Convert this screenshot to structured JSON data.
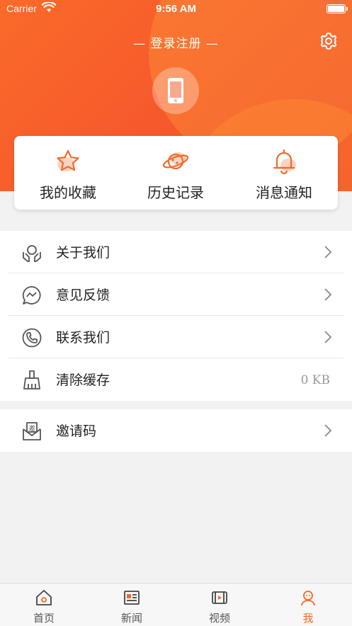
{
  "status_bar": {
    "carrier": "Carrier",
    "time": "9:56 AM"
  },
  "header": {
    "login_label": "— 登录注册 —"
  },
  "quick_actions": [
    {
      "label": "我的收藏",
      "icon": "star-icon"
    },
    {
      "label": "历史记录",
      "icon": "planet-icon"
    },
    {
      "label": "消息通知",
      "icon": "bell-icon"
    }
  ],
  "menu": {
    "about": {
      "label": "关于我们",
      "icon": "hands-heart-icon"
    },
    "feedback": {
      "label": "意见反馈",
      "icon": "chat-bubble-icon"
    },
    "contact": {
      "label": "联系我们",
      "icon": "phone-icon"
    },
    "cache": {
      "label": "清除缓存",
      "icon": "broom-icon",
      "value": "0 KB"
    },
    "invite": {
      "label": "邀请码",
      "icon": "envelope-icon"
    }
  },
  "tab_bar": [
    {
      "label": "首页",
      "icon": "home-icon",
      "active": false
    },
    {
      "label": "新闻",
      "icon": "newspaper-icon",
      "active": false
    },
    {
      "label": "视频",
      "icon": "video-icon",
      "active": false
    },
    {
      "label": "我",
      "icon": "user-icon",
      "active": true
    }
  ],
  "colors": {
    "accent": "#f26a2a",
    "header_start": "#fa6a2a",
    "header_end": "#ef4a2a",
    "background": "#f2f2f2"
  }
}
